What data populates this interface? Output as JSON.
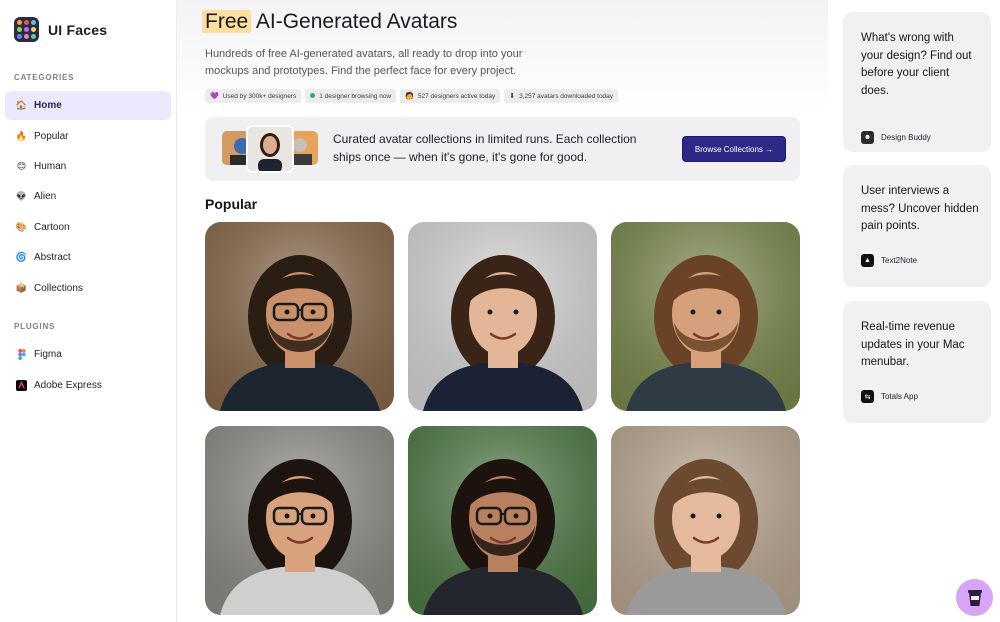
{
  "app": {
    "name": "UI Faces"
  },
  "sidebar": {
    "categories_label": "CATEGORIES",
    "categories": [
      {
        "label": "Home",
        "icon": "house-with-person-icon",
        "glyph": "🏠",
        "active": true
      },
      {
        "label": "Popular",
        "icon": "fire-icon",
        "glyph": "🔥"
      },
      {
        "label": "Human",
        "icon": "smiley-face-icon",
        "glyph": "😊"
      },
      {
        "label": "Alien",
        "icon": "alien-icon",
        "glyph": "👽"
      },
      {
        "label": "Cartoon",
        "icon": "palette-icon",
        "glyph": "🎨"
      },
      {
        "label": "Abstract",
        "icon": "spiral-icon",
        "glyph": "🌀"
      },
      {
        "label": "Collections",
        "icon": "package-icon",
        "glyph": "📦"
      }
    ],
    "plugins_label": "PLUGINS",
    "plugins": [
      {
        "label": "Figma",
        "icon": "figma-icon"
      },
      {
        "label": "Adobe Express",
        "icon": "adobe-express-icon"
      }
    ]
  },
  "hero": {
    "title_highlight": "Free",
    "title_rest": " AI-Generated Avatars",
    "subtitle": "Hundreds of free AI-generated avatars, all ready to drop into your mockups and prototypes. Find the perfect face for every project.",
    "badges": [
      {
        "icon": "purple-heart-icon",
        "glyph": "💜",
        "text": "Used by 300k+ designers"
      },
      {
        "icon": "green-dot-icon",
        "glyph": "",
        "text": "1 designer browsing now"
      },
      {
        "icon": "person-icon",
        "glyph": "🧑",
        "text": "527 designers active today"
      },
      {
        "icon": "download-arrow-icon",
        "glyph": "⬇",
        "text": "3,257 avatars downloaded today"
      }
    ]
  },
  "promo": {
    "text": "Curated avatar collections in limited runs. Each collection ships once — when it's gone, it's gone for good.",
    "button_label": "Browse Collections →"
  },
  "popular": {
    "title": "Popular",
    "avatars": [
      {
        "name": "avatar-1",
        "bg": "#8a6a4a",
        "skin": "#c9906a",
        "hair": "#2a1d14",
        "shirt": "#1d2630",
        "glasses": true,
        "beard": true
      },
      {
        "name": "avatar-2",
        "bg": "#d9d9d9",
        "skin": "#e2b697",
        "hair": "#3a2418",
        "shirt": "#1b2236",
        "glasses": false,
        "beard": false
      },
      {
        "name": "avatar-3",
        "bg": "#7d8b4e",
        "skin": "#d6a07c",
        "hair": "#6a4326",
        "shirt": "#2e3a44",
        "glasses": false,
        "beard": true
      },
      {
        "name": "avatar-4",
        "bg": "#8d8e86",
        "skin": "#d8a27f",
        "hair": "#1d1410",
        "shirt": "#cfcfcf",
        "glasses": true,
        "beard": false
      },
      {
        "name": "avatar-5",
        "bg": "#4f7b46",
        "skin": "#b98060",
        "hair": "#1c130f",
        "shirt": "#23272d",
        "glasses": true,
        "beard": true
      },
      {
        "name": "avatar-6",
        "bg": "#bca892",
        "skin": "#e4b99e",
        "hair": "#6b4a30",
        "shirt": "#9a9a9a",
        "glasses": false,
        "beard": false
      }
    ]
  },
  "ads": [
    {
      "text": "What's wrong with your design? Find out before your client does.",
      "brand": "Design Buddy",
      "icon": "design-buddy-logo-icon",
      "logo_bg": "#2d2d2d",
      "logo_glyph": "☻"
    },
    {
      "text": "User interviews a mess? Uncover hidden pain points.",
      "brand": "Text2Note",
      "icon": "text2note-logo-icon",
      "logo_bg": "#111111",
      "logo_glyph": "▲"
    },
    {
      "text": "Real-time revenue updates in your Mac menubar.",
      "brand": "Totals App",
      "icon": "totals-app-logo-icon",
      "logo_bg": "#111111",
      "logo_glyph": "⇆"
    }
  ],
  "fab": {
    "icon": "coffee-cup-icon"
  }
}
